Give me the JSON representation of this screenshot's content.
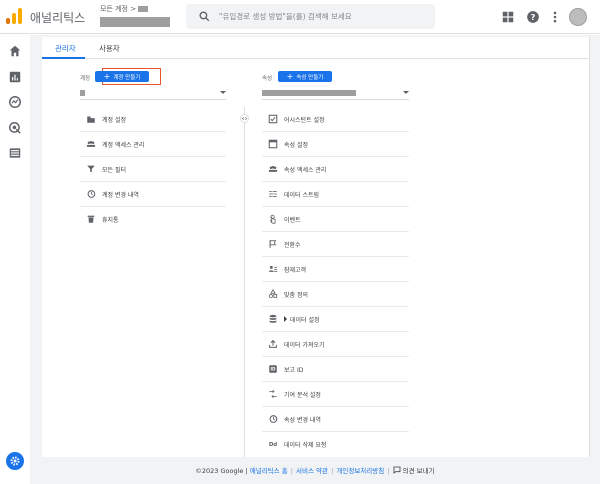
{
  "header": {
    "app_title": "애널리틱스",
    "account_prefix": "모든 계정 >",
    "search_placeholder": "\"유입경로 생성 방법\"을(를) 검색해 보세요"
  },
  "tabs": [
    {
      "label": "관리자",
      "active": true
    },
    {
      "label": "사용자",
      "active": false
    }
  ],
  "account_column": {
    "label": "계정",
    "create_button": "계정 만들기",
    "items": [
      {
        "icon": "building-icon",
        "label": "계정 설정"
      },
      {
        "icon": "people-icon",
        "label": "계정 액세스 관리"
      },
      {
        "icon": "filter-icon",
        "label": "모든 필터"
      },
      {
        "icon": "history-icon",
        "label": "계정 변경 내역"
      },
      {
        "icon": "trash-icon",
        "label": "휴지통"
      }
    ]
  },
  "property_column": {
    "label": "속성",
    "create_button": "속성 만들기",
    "items": [
      {
        "icon": "checklist-icon",
        "label": "어시스턴트 설정"
      },
      {
        "icon": "window-icon",
        "label": "속성 설정"
      },
      {
        "icon": "people-icon",
        "label": "속성 액세스 관리"
      },
      {
        "icon": "stream-icon",
        "label": "데이터 스트림"
      },
      {
        "icon": "touch-icon",
        "label": "이벤트"
      },
      {
        "icon": "flag-icon",
        "label": "전환수"
      },
      {
        "icon": "audience-icon",
        "label": "잠재고객"
      },
      {
        "icon": "shapes-icon",
        "label": "맞춤 정의"
      },
      {
        "icon": "database-icon",
        "label": "데이터 설정"
      },
      {
        "icon": "upload-icon",
        "label": "데이터 가져오기"
      },
      {
        "icon": "id-icon",
        "label": "보고 ID"
      },
      {
        "icon": "attribution-icon",
        "label": "기여 분석 설정"
      },
      {
        "icon": "history-icon",
        "label": "속성 변경 내역"
      },
      {
        "icon": "dd-icon",
        "label": "데이터 삭제 요청"
      }
    ]
  },
  "footer": {
    "copyright": "©2023 Google |",
    "home_link": "애널리틱스 홈",
    "tos_link": "서비스 약관",
    "privacy_link": "개인정보처리방침",
    "feedback": "의견 보내기"
  },
  "colors": {
    "accent": "#1a73e8",
    "highlight": "#e8542b",
    "logo_orange": "#f9ab00",
    "logo_dark": "#e37400"
  }
}
